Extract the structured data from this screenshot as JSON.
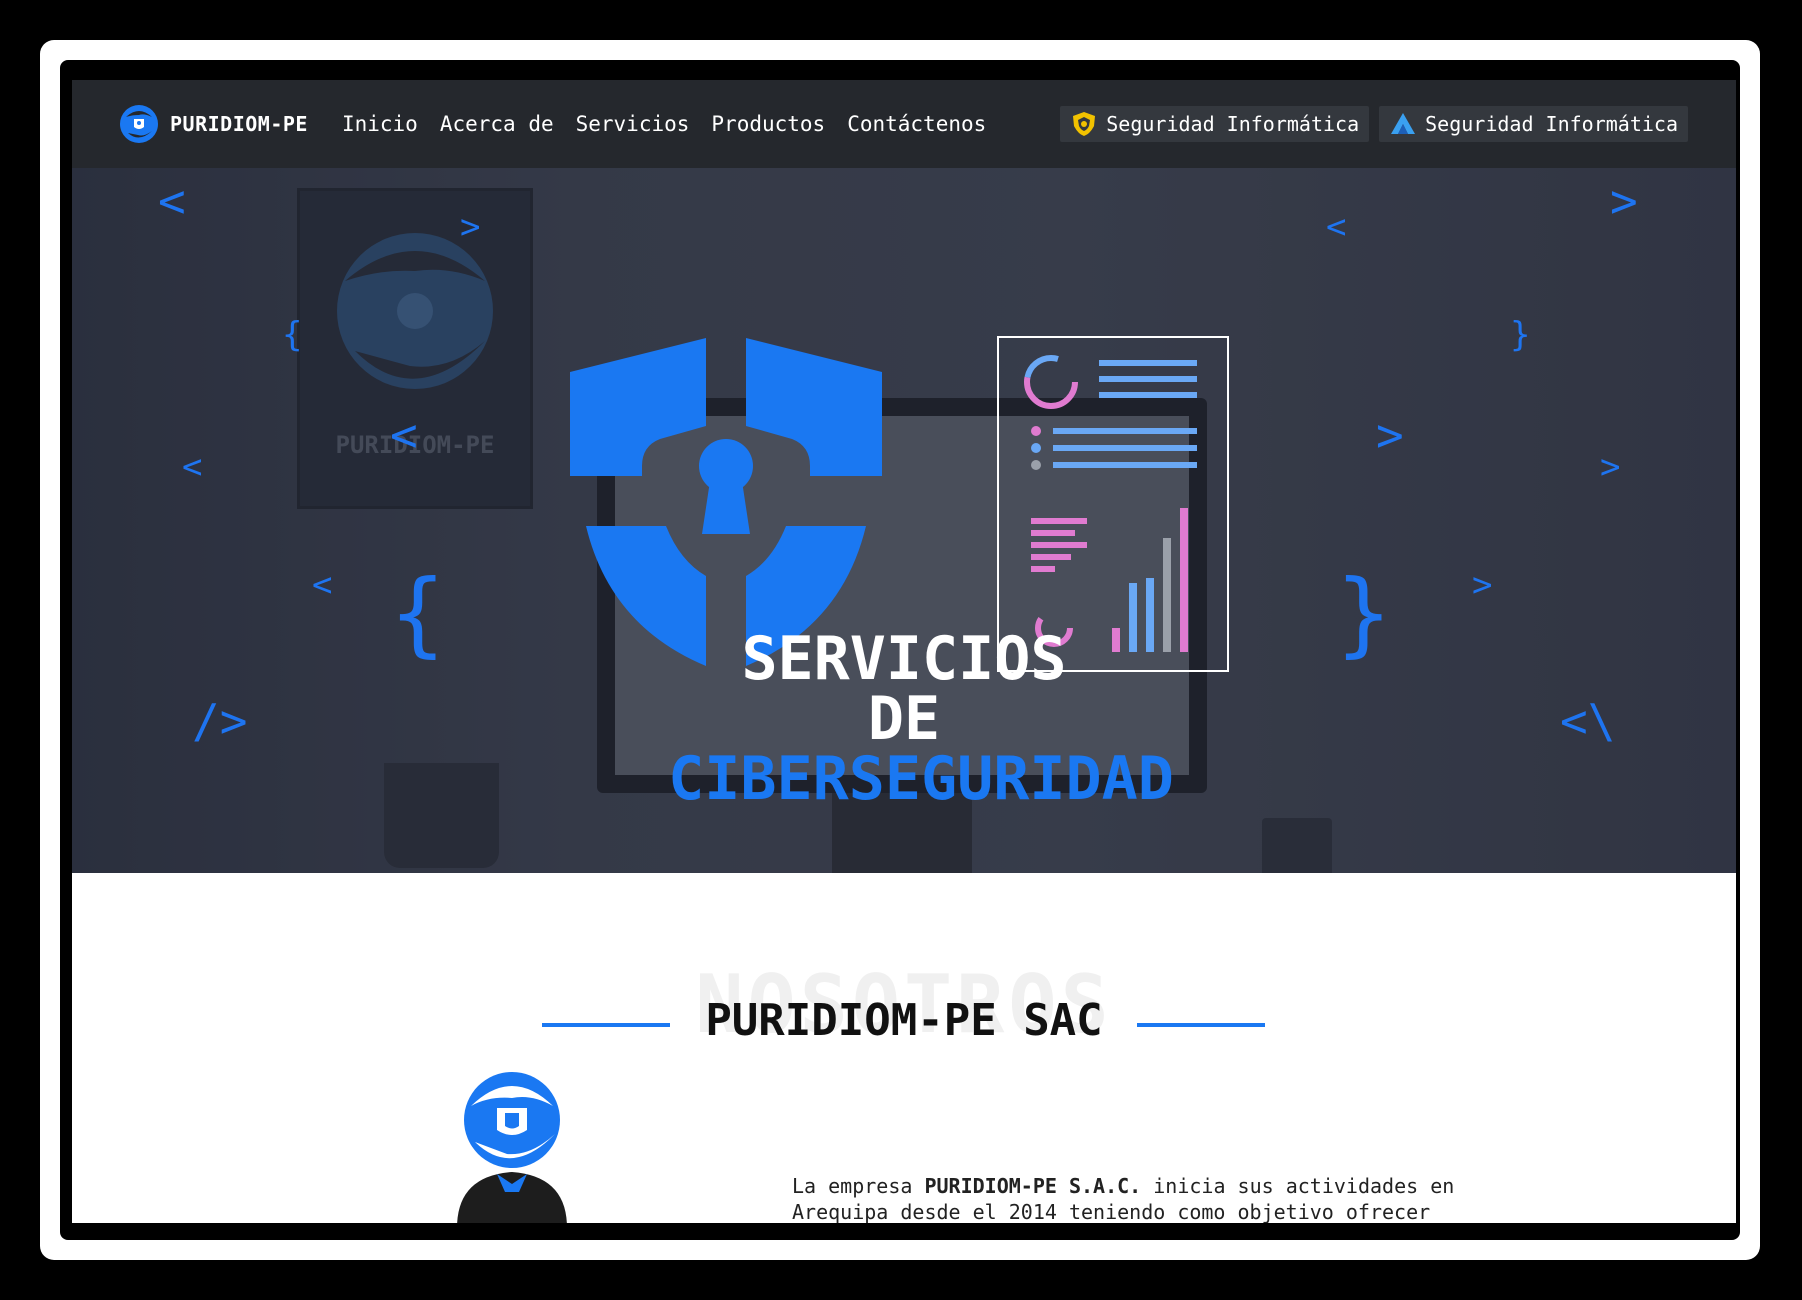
{
  "nav": {
    "brand": "PURIDIOM-PE",
    "menu": [
      "Inicio",
      "Acerca de",
      "Servicios",
      "Productos",
      "Contáctenos"
    ],
    "badges": [
      "Seguridad Informática",
      "Seguridad Informática"
    ]
  },
  "hero": {
    "poster_text": "PURIDIOM-PE",
    "title_line1": "SERVICIOS",
    "title_line2": "DE",
    "title_line3": "CIBERSEGURIDAD",
    "deco": {
      "lt": "<",
      "gt": ">",
      "lbrace": "{",
      "rbrace": "}",
      "close_tag": "/>",
      "open_tag": "<\\"
    }
  },
  "about": {
    "ghost": "NOSOTROS",
    "title": "PURIDIOM-PE SAC",
    "desc_prefix": "La empresa ",
    "desc_company": "PURIDIOM-PE S.A.C.",
    "desc_suffix": " inicia sus actividades en Arequipa desde el 2014 teniendo como objetivo ofrecer"
  },
  "colors": {
    "accent": "#1a78f2",
    "nav_bg": "#25282d",
    "badge_bg": "#34383e"
  },
  "icons": [
    "puridiom-logo-icon",
    "shield-badge-icon",
    "mountain-logo-icon",
    "shield-keyhole-icon",
    "report-chart-icon"
  ]
}
